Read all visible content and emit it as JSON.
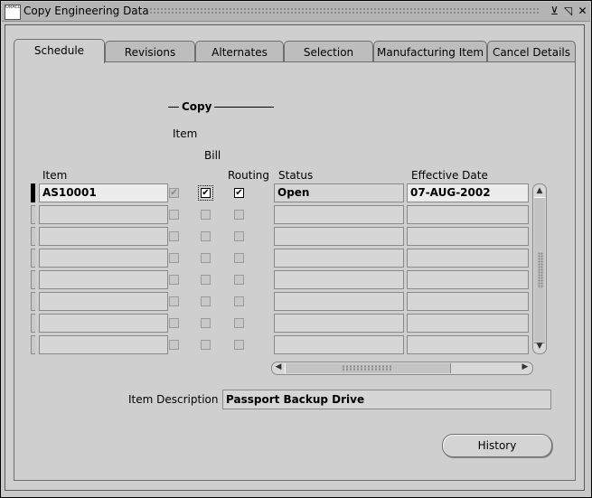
{
  "window": {
    "title": "Copy Engineering Data",
    "app_icon_text": "ORACLE",
    "minimize_glyph": "⊻",
    "maximize_glyph": "◹",
    "close_glyph": "✕"
  },
  "tabs": [
    {
      "label": "Schedule",
      "active": true
    },
    {
      "label": "Revisions",
      "active": false
    },
    {
      "label": "Alternates",
      "active": false
    },
    {
      "label": "Selection",
      "active": false
    },
    {
      "label": "Manufacturing Item",
      "active": false
    },
    {
      "label": "Cancel Details",
      "active": false
    }
  ],
  "copy_group": {
    "title": "Copy",
    "item_label": "Item",
    "bill_label": "Bill",
    "routing_label": "Routing"
  },
  "columns": {
    "item": "Item",
    "status": "Status",
    "effective_date": "Effective Date"
  },
  "rows": [
    {
      "item": "AS10001",
      "copy_item": true,
      "copy_bill": true,
      "copy_routing": true,
      "status": "Open",
      "effective_date": "07-AUG-2002"
    },
    {
      "item": "",
      "copy_item": false,
      "copy_bill": false,
      "copy_routing": false,
      "status": "",
      "effective_date": ""
    },
    {
      "item": "",
      "copy_item": false,
      "copy_bill": false,
      "copy_routing": false,
      "status": "",
      "effective_date": ""
    },
    {
      "item": "",
      "copy_item": false,
      "copy_bill": false,
      "copy_routing": false,
      "status": "",
      "effective_date": ""
    },
    {
      "item": "",
      "copy_item": false,
      "copy_bill": false,
      "copy_routing": false,
      "status": "",
      "effective_date": ""
    },
    {
      "item": "",
      "copy_item": false,
      "copy_bill": false,
      "copy_routing": false,
      "status": "",
      "effective_date": ""
    },
    {
      "item": "",
      "copy_item": false,
      "copy_bill": false,
      "copy_routing": false,
      "status": "",
      "effective_date": ""
    },
    {
      "item": "",
      "copy_item": false,
      "copy_bill": false,
      "copy_routing": false,
      "status": "",
      "effective_date": ""
    }
  ],
  "item_description": {
    "label": "Item Description",
    "value": "Passport Backup Drive"
  },
  "buttons": {
    "history": "History"
  },
  "icons": {
    "check": "✔",
    "scroll_up": "▲",
    "scroll_down": "▼",
    "scroll_left": "◀",
    "scroll_right": "▶"
  }
}
